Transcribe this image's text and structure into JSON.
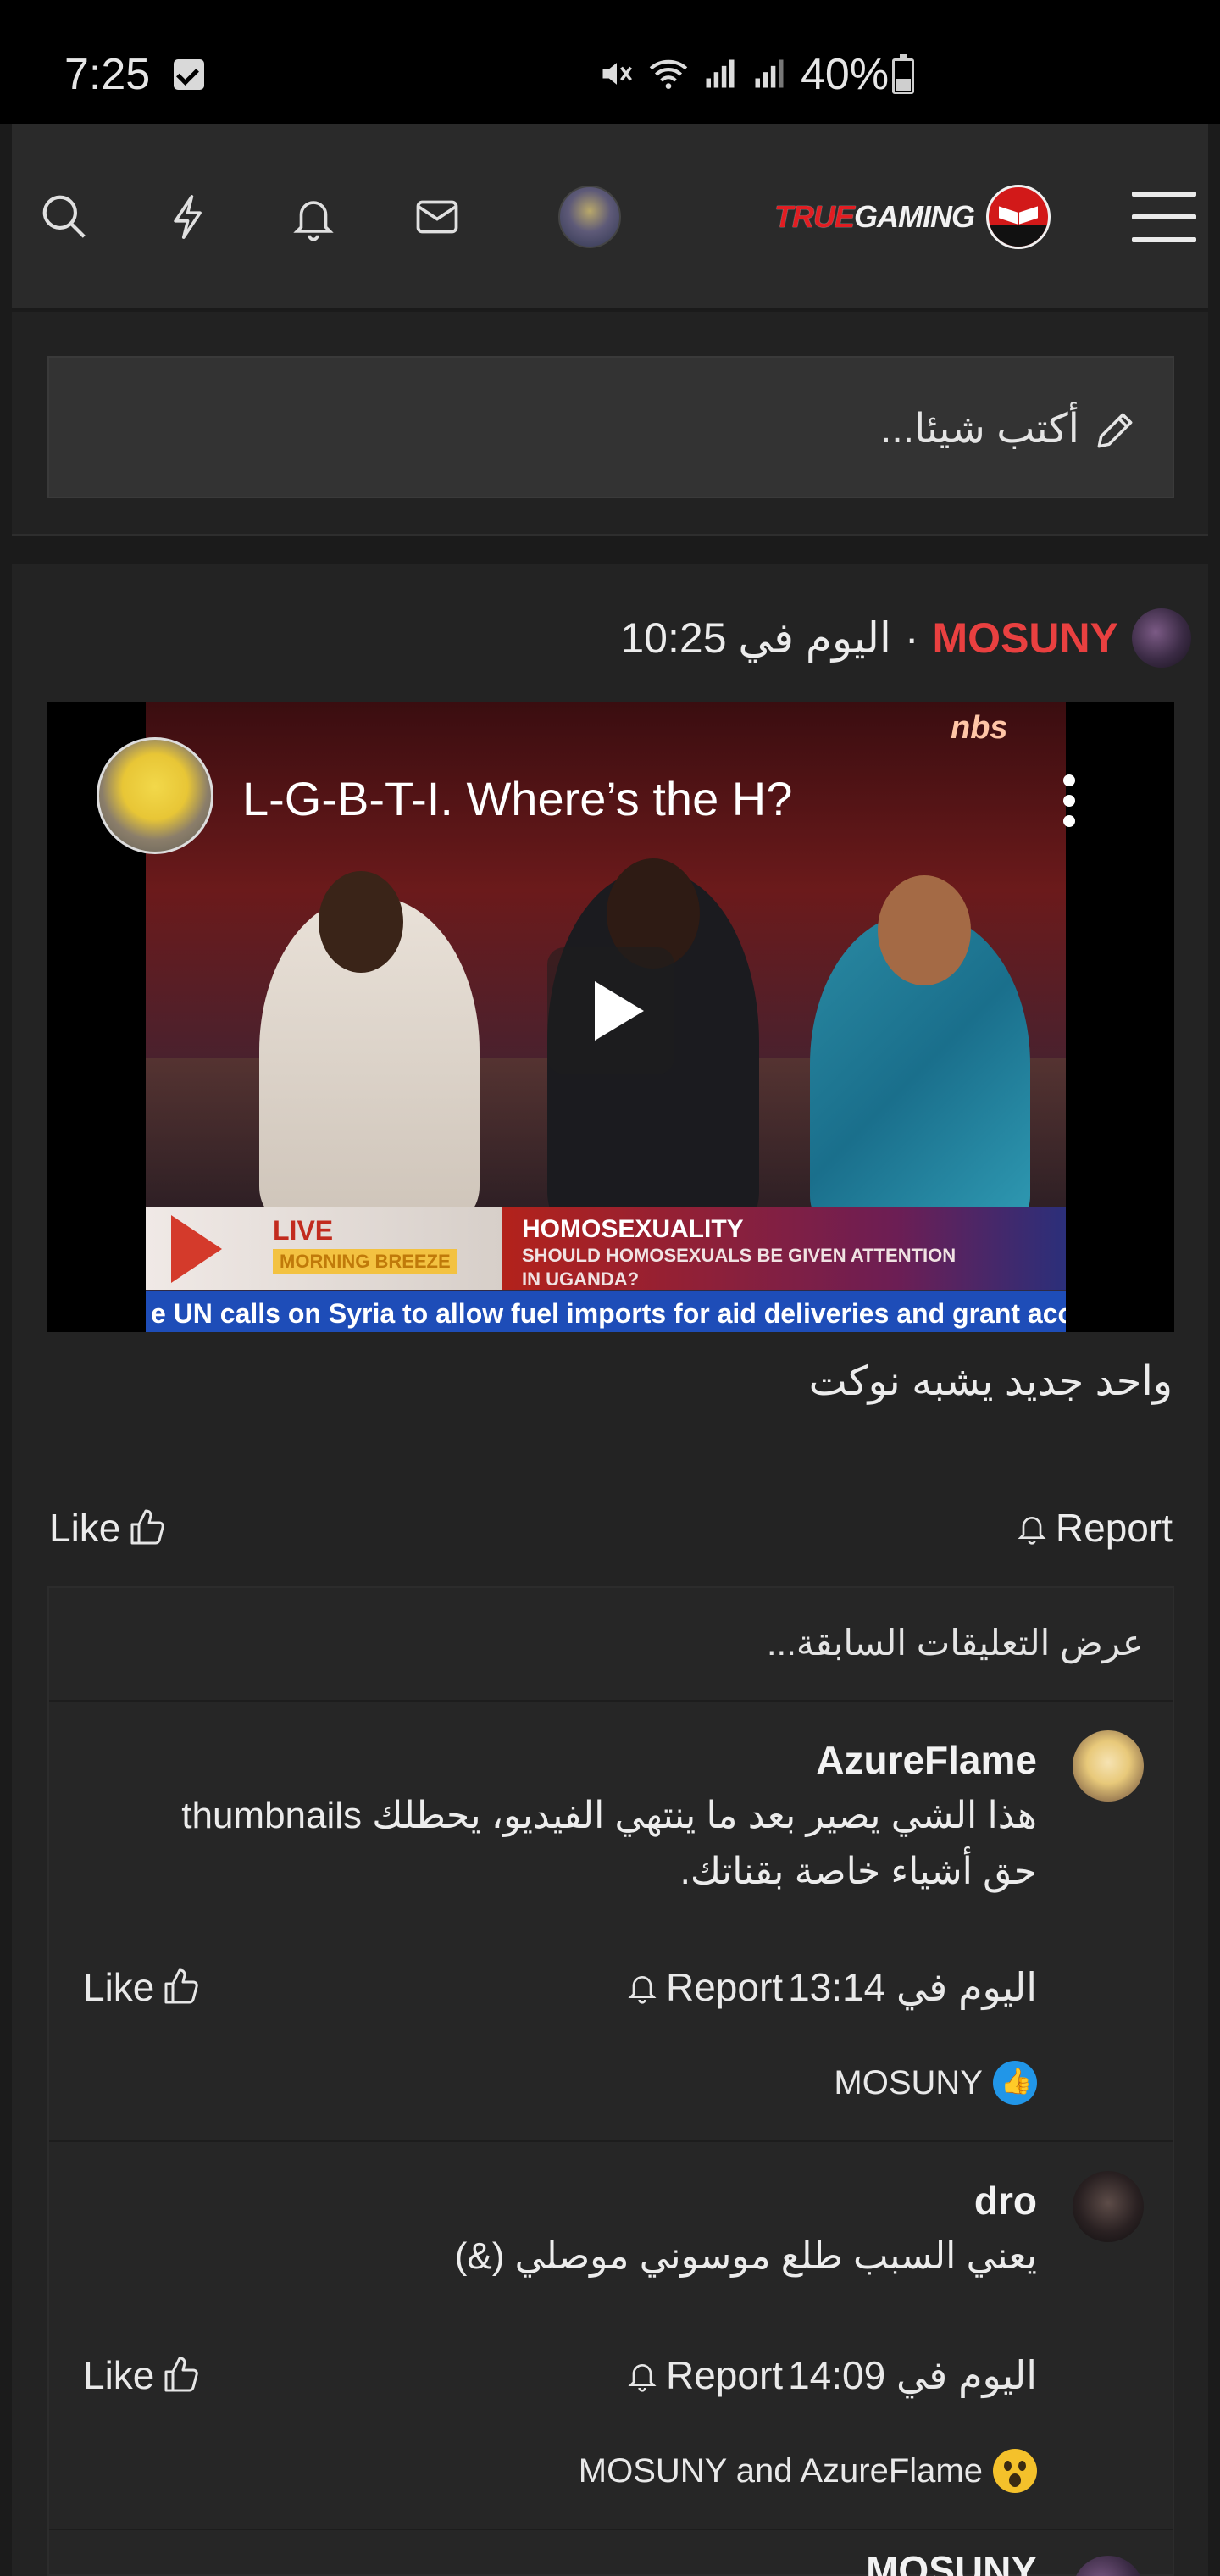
{
  "status_bar": {
    "time": "7:25",
    "battery": "40%",
    "icons": [
      "checkbox-notification-icon",
      "mute-icon",
      "wifi-icon",
      "signal-icon",
      "signal-icon",
      "battery-icon"
    ]
  },
  "header": {
    "icons": [
      "search-icon",
      "lightning-icon",
      "bell-icon",
      "mail-icon"
    ],
    "logo_part1": "TRUE",
    "logo_part2": "GAMING",
    "menu_icon": "hamburger-icon"
  },
  "composer": {
    "placeholder": "أكتب شيئا..."
  },
  "post": {
    "author": "MOSUNY",
    "time": "اليوم في 10:25",
    "separator": "·",
    "video": {
      "title": "L-G-B-T-I. Where’s the H?",
      "lower_third_live": "LIVE",
      "lower_third_show": "MORNING BREEZE",
      "lower_third_topic": "HOMOSEXUALITY",
      "lower_third_question_1": "SHOULD HOMOSEXUALS BE GIVEN ATTENTION",
      "lower_third_question_2": "IN UGANDA?",
      "ticker": "e UN calls on Syria to allow fuel imports for aid deliveries and grant acc",
      "channel_logo": "nbs"
    },
    "text": "واحد جديد يشبه نوكت",
    "like_label": "Like",
    "report_label": "Report"
  },
  "comments": {
    "previous_label": "عرض التعليقات السابقة...",
    "items": [
      {
        "author": "AzureFlame",
        "body": "هذا الشي يصير بعد ما ينتهي الفيديو، يحطلك thumbnails حق أشياء خاصة بقناتك.",
        "time": "اليوم في 13:14",
        "like_label": "Like",
        "report_label": "Report",
        "reactions": "MOSUNY"
      },
      {
        "author": "dro",
        "body": "يعني السبب طلع موسوني موصلي (&)",
        "time": "اليوم في 14:09",
        "like_label": "Like",
        "report_label": "Report",
        "reactions": "MOSUNY and AzureFlame"
      },
      {
        "author": "MOSUNY"
      }
    ]
  }
}
